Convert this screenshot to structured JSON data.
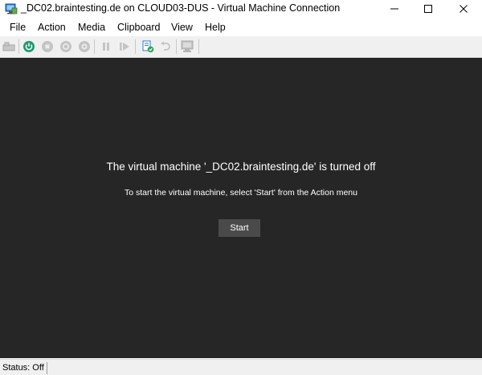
{
  "window": {
    "title": "_DC02.braintesting.de on CLOUD03-DUS - Virtual Machine Connection",
    "app_icon": "vm-connection-icon",
    "controls": [
      "minimize-icon",
      "maximize-icon",
      "close-icon"
    ]
  },
  "menu": {
    "items": [
      {
        "label": "File"
      },
      {
        "label": "Action"
      },
      {
        "label": "Media"
      },
      {
        "label": "Clipboard"
      },
      {
        "label": "View"
      },
      {
        "label": "Help"
      }
    ]
  },
  "toolbar": {
    "buttons": [
      {
        "icon": "ctrl-alt-del-icon",
        "enabled": false
      },
      {
        "icon": "start-icon",
        "enabled": true,
        "color": "#1a9a6c"
      },
      {
        "icon": "turn-off-icon",
        "enabled": false
      },
      {
        "icon": "shut-down-icon",
        "enabled": false
      },
      {
        "icon": "save-icon",
        "enabled": false
      },
      {
        "icon": "pause-icon",
        "enabled": false
      },
      {
        "icon": "resume-icon",
        "enabled": false
      },
      {
        "icon": "checkpoint-icon",
        "enabled": true
      },
      {
        "icon": "revert-icon",
        "enabled": false
      },
      {
        "icon": "enhanced-session-icon",
        "enabled": false
      }
    ]
  },
  "vm": {
    "message_title": "The virtual machine '_DC02.braintesting.de' is turned off",
    "message_subtitle": "To start the virtual machine, select 'Start' from the Action menu",
    "start_button_label": "Start",
    "background_color": "#262626"
  },
  "status": {
    "text": "Status: Off"
  }
}
